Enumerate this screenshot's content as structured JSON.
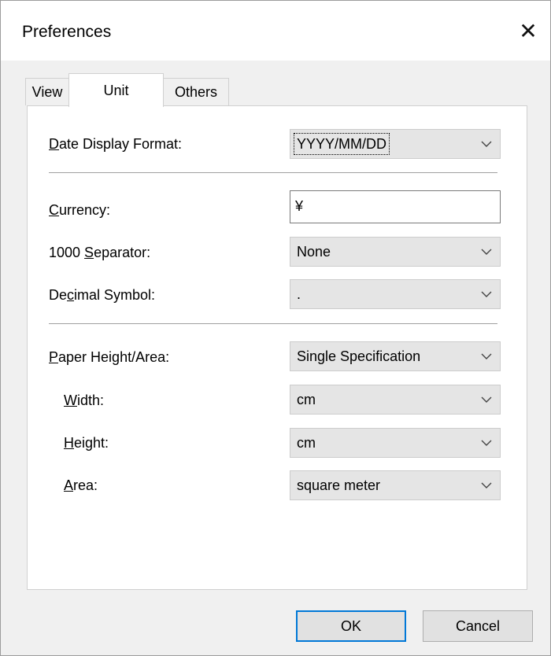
{
  "window": {
    "title": "Preferences",
    "close_glyph": "✕"
  },
  "tabs": [
    {
      "label": "View",
      "active": false
    },
    {
      "label": "Unit",
      "active": true
    },
    {
      "label": "Others",
      "active": false
    }
  ],
  "fields": {
    "date_display_format": {
      "label_pre": "",
      "label_key": "D",
      "label_post": "ate Display Format:",
      "value": "YYYY/MM/DD"
    },
    "currency": {
      "label_pre": "",
      "label_key": "C",
      "label_post": "urrency:",
      "value": "¥"
    },
    "separator": {
      "label_pre": "1000 ",
      "label_key": "S",
      "label_post": "eparator:",
      "value": "None"
    },
    "decimal_symbol": {
      "label_pre": "De",
      "label_key": "c",
      "label_post": "imal Symbol:",
      "value": "."
    },
    "paper_height_area": {
      "label_pre": "",
      "label_key": "P",
      "label_post": "aper Height/Area:",
      "value": "Single Specification"
    },
    "width": {
      "label_pre": "",
      "label_key": "W",
      "label_post": "idth:",
      "value": "cm"
    },
    "height": {
      "label_pre": "",
      "label_key": "H",
      "label_post": "eight:",
      "value": "cm"
    },
    "area": {
      "label_pre": "",
      "label_key": "A",
      "label_post": "rea:",
      "value": "square meter"
    }
  },
  "buttons": {
    "ok": "OK",
    "cancel": "Cancel"
  },
  "colors": {
    "accent": "#0078d7",
    "combo_bg": "#e5e5e5",
    "panel_bg": "#ffffff"
  }
}
